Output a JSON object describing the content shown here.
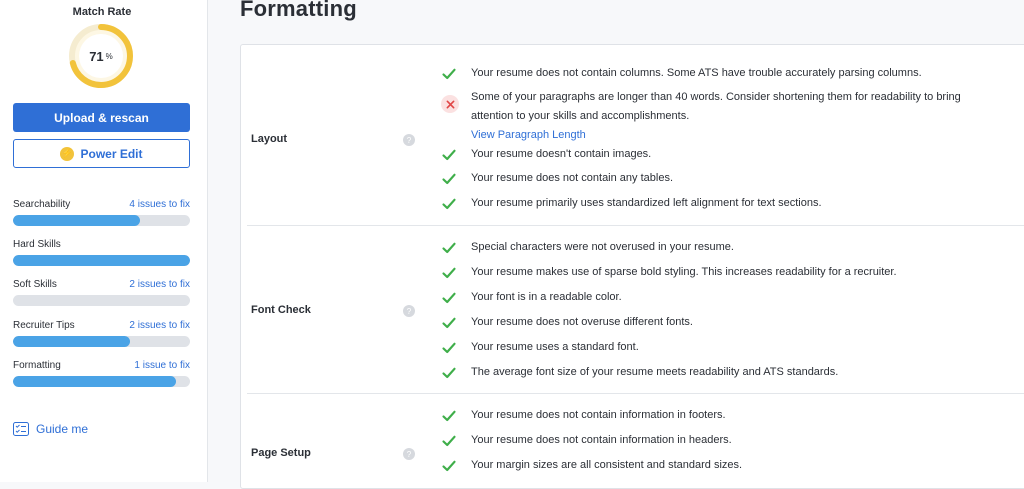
{
  "sidebar": {
    "match_rate_title": "Match Rate",
    "match_rate_value": "71",
    "match_rate_unit": "%",
    "match_rate_fraction": 0.71,
    "upload_button": "Upload & rescan",
    "power_edit_button": "Power Edit",
    "scores": [
      {
        "label": "Searchability",
        "link": "4 issues to fix",
        "fill": 0.72
      },
      {
        "label": "Hard Skills",
        "link": "",
        "fill": 1.0
      },
      {
        "label": "Soft Skills",
        "link": "2 issues to fix",
        "fill": 0.0
      },
      {
        "label": "Recruiter Tips",
        "link": "2 issues to fix",
        "fill": 0.66
      },
      {
        "label": "Formatting",
        "link": "1 issue to fix",
        "fill": 0.92
      }
    ],
    "guide_me": "Guide me"
  },
  "main": {
    "title": "Formatting",
    "sections": [
      {
        "label": "Layout",
        "items": [
          {
            "status": "pass",
            "text": "Your resume does not contain columns. Some ATS have trouble accurately parsing columns."
          },
          {
            "status": "fail",
            "text": "Some of your paragraphs are longer than 40 words. Consider shortening them for readability to bring attention to your skills and accomplishments.",
            "link": "View Paragraph Length"
          },
          {
            "status": "pass",
            "text": "Your resume doesn't contain images."
          },
          {
            "status": "pass",
            "text": "Your resume does not contain any tables."
          },
          {
            "status": "pass",
            "text": "Your resume primarily uses standardized left alignment for text sections."
          }
        ]
      },
      {
        "label": "Font Check",
        "items": [
          {
            "status": "pass",
            "text": "Special characters were not overused in your resume."
          },
          {
            "status": "pass",
            "text": "Your resume makes use of sparse bold styling. This increases readability for a recruiter."
          },
          {
            "status": "pass",
            "text": "Your font is in a readable color."
          },
          {
            "status": "pass",
            "text": "Your resume does not overuse different fonts."
          },
          {
            "status": "pass",
            "text": "Your resume uses a standard font."
          },
          {
            "status": "pass",
            "text": "The average font size of your resume meets readability and ATS standards."
          }
        ]
      },
      {
        "label": "Page Setup",
        "items": [
          {
            "status": "pass",
            "text": "Your resume does not contain information in footers."
          },
          {
            "status": "pass",
            "text": "Your resume does not contain information in headers."
          },
          {
            "status": "pass",
            "text": "Your margin sizes are all consistent and standard sizes."
          }
        ]
      }
    ],
    "help_glyph": "?"
  },
  "colors": {
    "accent": "#2f6fd6",
    "bar_fill": "#4aa3e6",
    "pass_check": "#3fae4a",
    "fail_x": "#e14646",
    "gauge": "#f2c33b"
  }
}
